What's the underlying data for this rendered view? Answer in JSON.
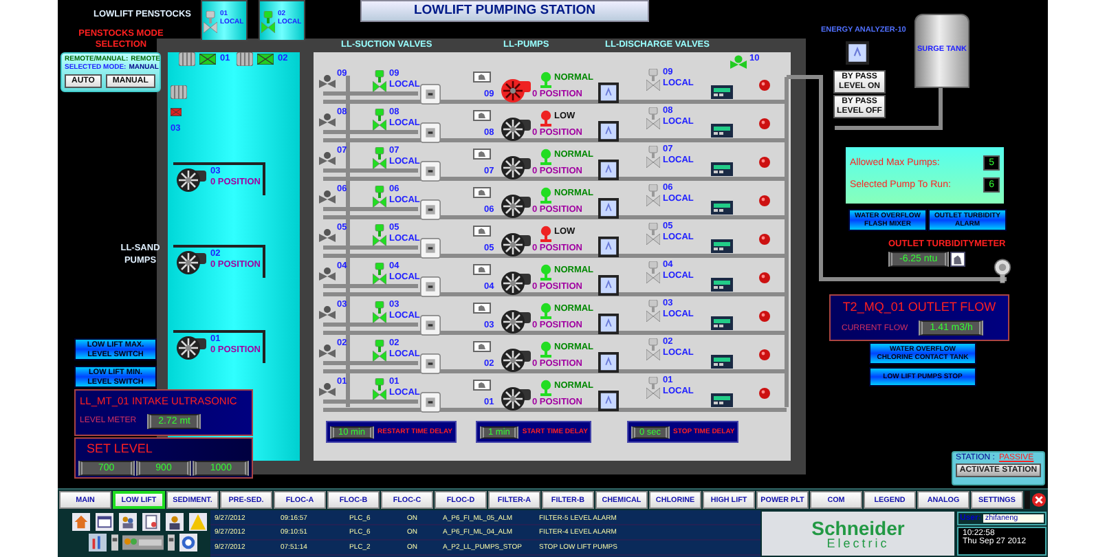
{
  "title": "LOWLIFT PUMPING STATION",
  "penstocks": {
    "heading": "LOWLIFT PENSTOCKS",
    "items": [
      {
        "label": "01",
        "mode": "LOCAL",
        "open": false
      },
      {
        "label": "02",
        "mode": "LOCAL",
        "open": true
      }
    ]
  },
  "mode_selection": {
    "heading": "PENSTOCKS MODE SELECTION",
    "remote_label": "REMOTE/MANUAL:",
    "remote_value": "REMOTE",
    "selected_label": "SELECTED MODE:",
    "selected_value": "MANUAL",
    "buttons": [
      "AUTO",
      "MANUAL"
    ]
  },
  "gates": [
    {
      "label": "01",
      "open": true
    },
    {
      "label": "02",
      "open": true
    },
    {
      "label": "03",
      "open": false
    }
  ],
  "sand_pumps": {
    "heading": "LL-SAND PUMPS",
    "items": [
      {
        "label": "03",
        "position": "0 POSITION"
      },
      {
        "label": "02",
        "position": "0 POSITION"
      },
      {
        "label": "01",
        "position": "0 POSITION"
      }
    ]
  },
  "level_switches": [
    "LOW LIFT MAX. LEVEL SWITCH",
    "LOW LIFT MIN. LEVEL SWITCH"
  ],
  "intake": {
    "title": "LL_MT_01 INTAKE ULTRASONIC",
    "meter_label": "LEVEL METER",
    "meter_value": "2.72 mt",
    "set_title": "SET LEVEL",
    "set_values": [
      "700",
      "900",
      "1000"
    ]
  },
  "sections": [
    "LL-SUCTION VALVES",
    "LL-PUMPS",
    "LL-DISCHARGE VALVES"
  ],
  "rows": [
    {
      "inlet": "09",
      "suction": {
        "label": "09",
        "mode": "LOCAL",
        "open": true
      },
      "pump": {
        "label": "09",
        "alarm": true
      },
      "status": {
        "kind": "normal",
        "text": "NORMAL"
      },
      "position": "0 POSITION",
      "discharge": {
        "label": "09",
        "mode": "LOCAL",
        "open": false
      }
    },
    {
      "inlet": "08",
      "suction": {
        "label": "08",
        "mode": "LOCAL",
        "open": true
      },
      "pump": {
        "label": "08",
        "alarm": false
      },
      "status": {
        "kind": "low",
        "text": "LOW"
      },
      "position": "0 POSITION",
      "discharge": {
        "label": "08",
        "mode": "LOCAL",
        "open": false
      }
    },
    {
      "inlet": "07",
      "suction": {
        "label": "07",
        "mode": "LOCAL",
        "open": true
      },
      "pump": {
        "label": "07",
        "alarm": false
      },
      "status": {
        "kind": "normal",
        "text": "NORMAL"
      },
      "position": "0 POSITION",
      "discharge": {
        "label": "07",
        "mode": "LOCAL",
        "open": false
      }
    },
    {
      "inlet": "06",
      "suction": {
        "label": "06",
        "mode": "LOCAL",
        "open": true
      },
      "pump": {
        "label": "06",
        "alarm": false
      },
      "status": {
        "kind": "normal",
        "text": "NORMAL"
      },
      "position": "0 POSITION",
      "discharge": {
        "label": "06",
        "mode": "LOCAL",
        "open": false
      }
    },
    {
      "inlet": "05",
      "suction": {
        "label": "05",
        "mode": "LOCAL",
        "open": true
      },
      "pump": {
        "label": "05",
        "alarm": false
      },
      "status": {
        "kind": "low",
        "text": "LOW"
      },
      "position": "0 POSITION",
      "discharge": {
        "label": "05",
        "mode": "LOCAL",
        "open": false
      }
    },
    {
      "inlet": "04",
      "suction": {
        "label": "04",
        "mode": "LOCAL",
        "open": true
      },
      "pump": {
        "label": "04",
        "alarm": false
      },
      "status": {
        "kind": "normal",
        "text": "NORMAL"
      },
      "position": "0 POSITION",
      "discharge": {
        "label": "04",
        "mode": "LOCAL",
        "open": false
      }
    },
    {
      "inlet": "03",
      "suction": {
        "label": "03",
        "mode": "LOCAL",
        "open": true
      },
      "pump": {
        "label": "03",
        "alarm": false
      },
      "status": {
        "kind": "normal",
        "text": "NORMAL"
      },
      "position": "0 POSITION",
      "discharge": {
        "label": "03",
        "mode": "LOCAL",
        "open": false
      }
    },
    {
      "inlet": "02",
      "suction": {
        "label": "02",
        "mode": "LOCAL",
        "open": true
      },
      "pump": {
        "label": "02",
        "alarm": false
      },
      "status": {
        "kind": "normal",
        "text": "NORMAL"
      },
      "position": "0 POSITION",
      "discharge": {
        "label": "02",
        "mode": "LOCAL",
        "open": false
      }
    },
    {
      "inlet": "01",
      "suction": {
        "label": "01",
        "mode": "LOCAL",
        "open": true
      },
      "pump": {
        "label": "01",
        "alarm": false
      },
      "status": {
        "kind": "normal",
        "text": "NORMAL"
      },
      "position": "0 POSITION",
      "discharge": {
        "label": "01",
        "mode": "LOCAL",
        "open": false
      }
    }
  ],
  "outlet_valve": {
    "label": "10",
    "open": true
  },
  "delays": [
    {
      "value": "10 min",
      "label": "RESTART TIME DELAY"
    },
    {
      "value": "1 min",
      "label": "START TIME DELAY"
    },
    {
      "value": "0 sec",
      "label": "STOP TIME DELAY"
    }
  ],
  "energy_analyzer": "ENERGY ANALYZER-10",
  "bypass_buttons": [
    "BY PASS LEVEL ON",
    "BY PASS LEVEL OFF"
  ],
  "surge_tank": "SURGE TANK",
  "pump_settings": [
    {
      "label": "Allowed Max Pumps:",
      "value": "5"
    },
    {
      "label": "Selected Pump To Run:",
      "value": "6"
    }
  ],
  "alarm_buttons_top": [
    "WATER OVERFLOW FLASH MIXER",
    "OUTLET TURBIDITY ALARM"
  ],
  "turbidity": {
    "title": "OUTLET TURBIDITYMETER",
    "value": "-6.25 ntu"
  },
  "flow": {
    "title": "T2_MQ_01 OUTLET FLOW",
    "label": "CURRENT FLOW",
    "value": "1.41 m3/h"
  },
  "alarm_buttons_bottom": [
    "WATER OVERFLOW CHLORINE CONTACT TANK",
    "LOW LIFT PUMPS STOP"
  ],
  "station": {
    "label": "STATION :",
    "state": "PASSIVE",
    "button": "ACTIVATE STATION"
  },
  "tabs": [
    {
      "label": "MAIN",
      "selected": false
    },
    {
      "label": "LOW LIFT",
      "selected": true
    },
    {
      "label": "SEDIMENT.",
      "selected": false
    },
    {
      "label": "PRE-SED.",
      "selected": false
    },
    {
      "label": "FLOC-A",
      "selected": false
    },
    {
      "label": "FLOC-B",
      "selected": false
    },
    {
      "label": "FLOC-C",
      "selected": false
    },
    {
      "label": "FLOC-D",
      "selected": false
    },
    {
      "label": "FILTER-A",
      "selected": false
    },
    {
      "label": "FILTER-B",
      "selected": false
    },
    {
      "label": "CHEMICAL",
      "selected": false
    },
    {
      "label": "CHLORINE",
      "selected": false
    },
    {
      "label": "HIGH LIFT",
      "selected": false
    },
    {
      "label": "POWER PLT",
      "selected": false
    },
    {
      "label": "COM",
      "selected": false
    },
    {
      "label": "LEGEND",
      "selected": false
    },
    {
      "label": "ANALOG",
      "selected": false
    },
    {
      "label": "SETTINGS",
      "selected": false
    }
  ],
  "alarms": [
    {
      "date": "9/27/2012",
      "time": "09:16:57",
      "plc": "PLC_6",
      "state": "ON",
      "tag": "A_P6_FI_ML_05_ALM",
      "message": "FILTER-5 LEVEL ALARM"
    },
    {
      "date": "9/27/2012",
      "time": "09:10:51",
      "plc": "PLC_6",
      "state": "ON",
      "tag": "A_P6_FI_ML_04_ALM",
      "message": "FILTER-4 LEVEL ALARM"
    },
    {
      "date": "9/27/2012",
      "time": "07:51:14",
      "plc": "PLC_2",
      "state": "ON",
      "tag": "A_P2_LL_PUMPS_STOP",
      "message": "STOP LOW LIFT PUMPS"
    }
  ],
  "logo": {
    "line1": "Schneider",
    "line2": "Electric"
  },
  "user": {
    "label": "User:",
    "value": "zhifaneng"
  },
  "clock": {
    "time": "10:22:58",
    "date": "Thu Sep 27 2012"
  }
}
